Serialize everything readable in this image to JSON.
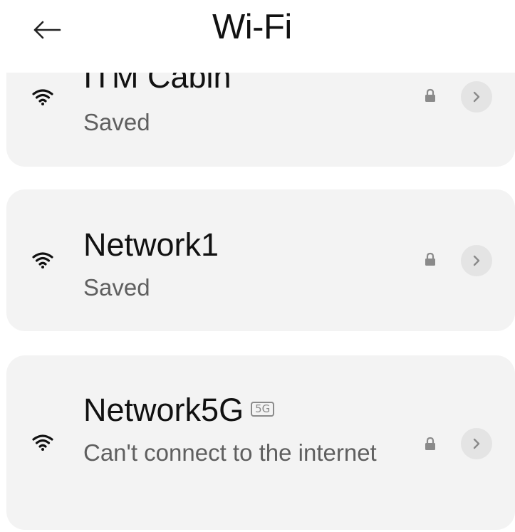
{
  "header": {
    "title": "Wi-Fi",
    "back_icon": "arrow-left-icon"
  },
  "networks": [
    {
      "name": "ITM Cabin",
      "status": "Saved",
      "band_badge": "",
      "secured": true
    },
    {
      "name": "Network1",
      "status": "Saved",
      "band_badge": "",
      "secured": true
    },
    {
      "name": "Network5G",
      "status": "Can't connect to the internet",
      "band_badge": "5G",
      "secured": true
    }
  ],
  "icons": {
    "signal": "wifi-signal-icon",
    "lock": "lock-icon",
    "details": "chevron-right-icon"
  },
  "colors": {
    "background": "#ffffff",
    "card": "#f3f3f3",
    "title_text": "#111111",
    "secondary_text": "#5f5f5f",
    "detail_button": "#e4e4e4",
    "icon_gray": "#8a8a8a"
  }
}
